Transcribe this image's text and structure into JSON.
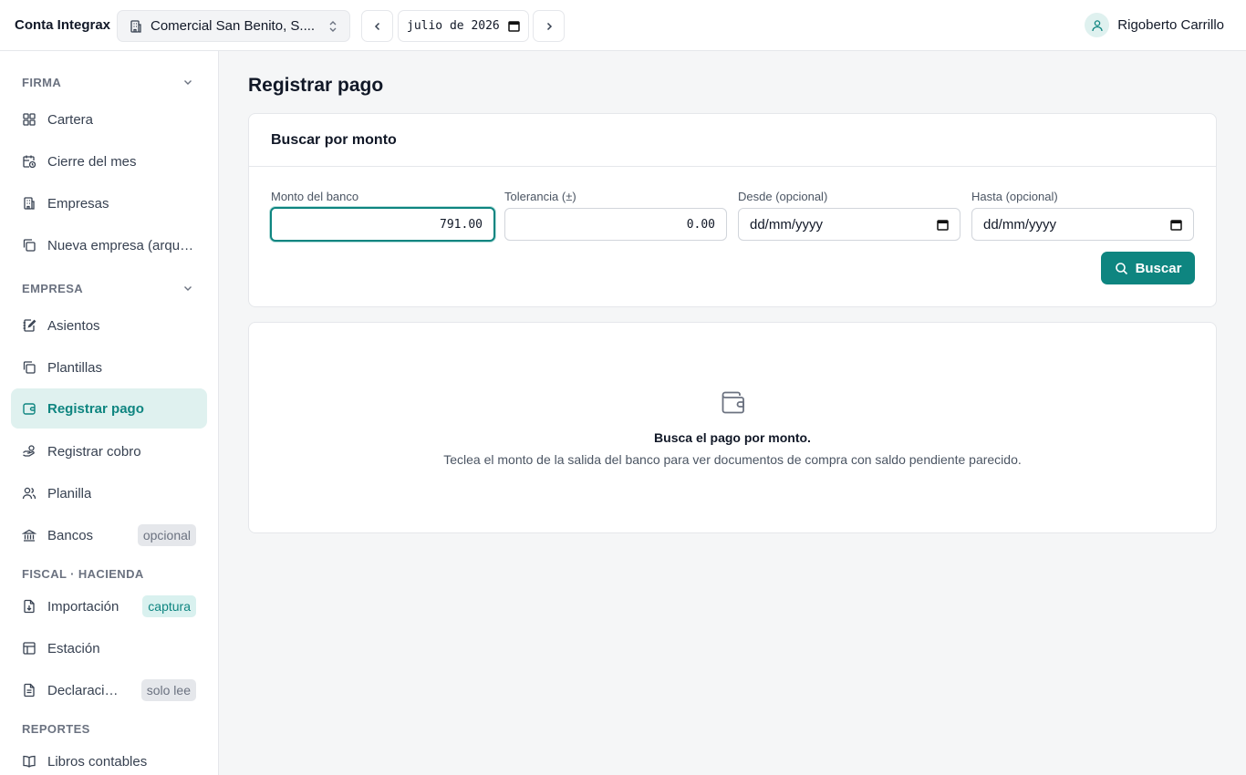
{
  "topbar": {
    "app_title": "Conta Integrax",
    "company": "Comercial San Benito, S....",
    "month_value": "julio de 2026",
    "user_name": "Rigoberto Carrillo"
  },
  "sidebar": {
    "sections": {
      "firma": "FIRMA",
      "empresa": "EMPRESA",
      "fiscal": "FISCAL · HACIENDA",
      "reportes": "REPORTES"
    },
    "items": [
      {
        "label": "Cartera",
        "icon": "grid-icon"
      },
      {
        "label": "Cierre del mes",
        "icon": "calendar-clock-icon"
      },
      {
        "label": "Empresas",
        "icon": "building-icon"
      },
      {
        "label": "Nueva empresa (arqueo)",
        "icon": "copy-icon"
      },
      {
        "label": "Asientos",
        "icon": "notebook-pen-icon"
      },
      {
        "label": "Plantillas",
        "icon": "copy-icon"
      },
      {
        "label": "Registrar pago",
        "icon": "wallet-icon",
        "active": true
      },
      {
        "label": "Registrar cobro",
        "icon": "hand-coins-icon"
      },
      {
        "label": "Planilla",
        "icon": "users-icon"
      },
      {
        "label": "Bancos",
        "icon": "landmark-icon",
        "badge": "opcional"
      },
      {
        "label": "Importación",
        "icon": "file-download-icon",
        "badge": "captura"
      },
      {
        "label": "Estación",
        "icon": "table-icon"
      },
      {
        "label": "Declaraciones",
        "icon": "file-text-icon",
        "badge": "solo lee"
      },
      {
        "label": "Libros contables",
        "icon": "book-open-icon"
      }
    ]
  },
  "main": {
    "page_title": "Registrar pago",
    "search_card": {
      "title": "Buscar por monto",
      "monto_label": "Monto del banco",
      "monto_value": "791.00",
      "tolerancia_label": "Tolerancia (±)",
      "tolerancia_value": "0.00",
      "desde_label": "Desde (opcional)",
      "desde_placeholder": "dd/mm/yyyy",
      "hasta_label": "Hasta (opcional)",
      "hasta_placeholder": "dd/mm/yyyy",
      "button_label": "Buscar"
    },
    "empty_state": {
      "title": "Busca el pago por monto.",
      "description": "Teclea el monto de la salida del banco para ver documentos de compra con saldo pendiente parecido."
    }
  },
  "colors": {
    "accent": "#0e8580",
    "accent_light": "#dff1ef"
  }
}
